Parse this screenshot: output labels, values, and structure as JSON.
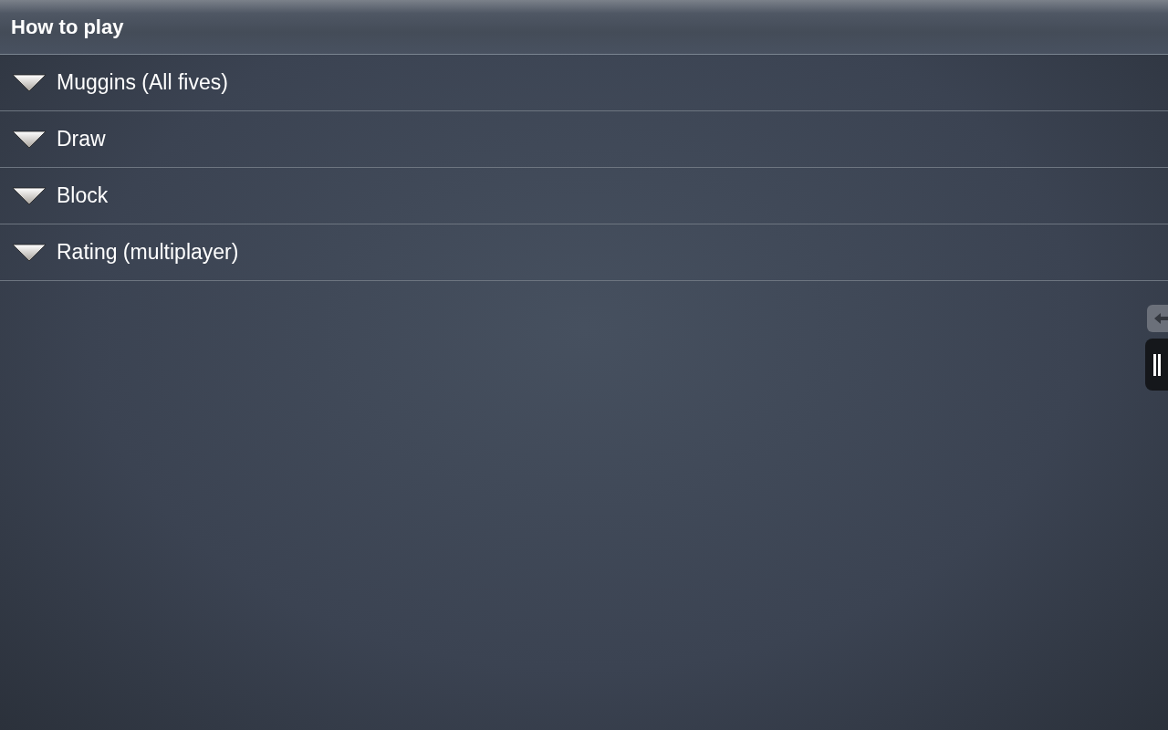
{
  "header": {
    "title": "How to play"
  },
  "sections": [
    {
      "label": "Muggins (All fives)",
      "expanded": false
    },
    {
      "label": "Draw",
      "expanded": false
    },
    {
      "label": "Block",
      "expanded": false
    },
    {
      "label": "Rating (multiplayer)",
      "expanded": false
    }
  ]
}
